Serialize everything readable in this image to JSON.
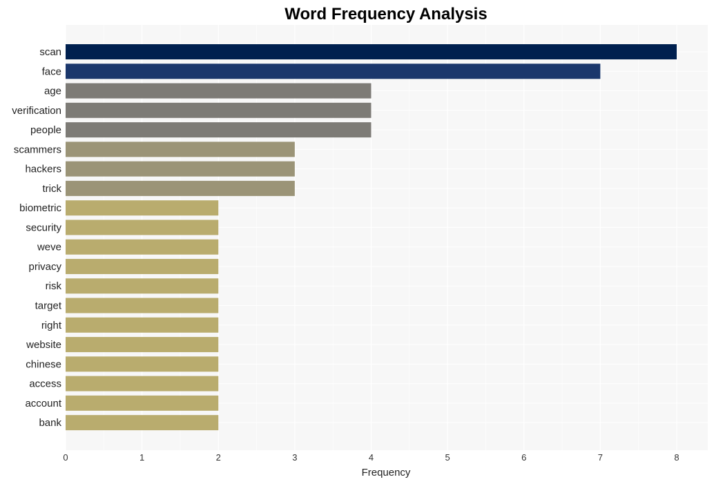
{
  "chart_data": {
    "type": "bar",
    "orientation": "horizontal",
    "title": "Word Frequency Analysis",
    "xlabel": "Frequency",
    "ylabel": "",
    "xlim": [
      0,
      8.4
    ],
    "xticks": [
      0,
      1,
      2,
      3,
      4,
      5,
      6,
      7,
      8
    ],
    "grid": true,
    "legend": "none",
    "categories": [
      "scan",
      "face",
      "age",
      "verification",
      "people",
      "scammers",
      "hackers",
      "trick",
      "biometric",
      "security",
      "weve",
      "privacy",
      "risk",
      "target",
      "right",
      "website",
      "chinese",
      "access",
      "account",
      "bank"
    ],
    "values": [
      8,
      7,
      4,
      4,
      4,
      3,
      3,
      3,
      2,
      2,
      2,
      2,
      2,
      2,
      2,
      2,
      2,
      2,
      2,
      2
    ],
    "colors": {
      "8": "#00204f",
      "7": "#1b376c",
      "4": "#7d7b76",
      "3": "#9b9477",
      "2": "#b9ac6e"
    },
    "plot_background": "#f7f7f7",
    "grid_color": "#ffffff"
  }
}
